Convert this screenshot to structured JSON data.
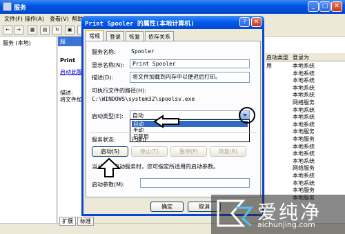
{
  "bg_window": {
    "title": "服务",
    "menu": [
      "文件(F)",
      "操作(A)",
      "查看(V)",
      "帮助(H)"
    ],
    "tree_item": "服务 (本地)",
    "mid_pane_header": "服",
    "mid_texts": [
      "Print",
      "启动此服",
      "描述:",
      "将文件加"
    ],
    "status_tabs": [
      "扩展",
      "标准"
    ],
    "right_pane": {
      "columns": [
        "启动类型",
        "登录为"
      ],
      "rows": [
        [
          "用",
          "本地系统"
        ],
        [
          "",
          "本地系统"
        ],
        [
          "",
          "本地系统"
        ],
        [
          "",
          "本地系统"
        ],
        [
          "",
          "本地系统"
        ],
        [
          "",
          "网络服务"
        ],
        [
          "",
          "本地系统"
        ],
        [
          "",
          "本地系统"
        ],
        [
          "",
          "本地系统"
        ],
        [
          "",
          "本地服务"
        ],
        [
          "",
          "本地服务"
        ],
        [
          "",
          "本地系统"
        ],
        [
          "",
          "本地系统"
        ],
        [
          "",
          "本地系统"
        ],
        [
          "",
          "网络服务"
        ],
        [
          "",
          "本地系统"
        ],
        [
          "",
          "本地系统"
        ],
        [
          "",
          "本地服务"
        ],
        [
          "",
          "本地服务"
        ]
      ]
    }
  },
  "dialog": {
    "title": "Print Spooler 的属性(本地计算机)",
    "tabs": [
      "常规",
      "登录",
      "恢复",
      "依存关系"
    ],
    "service_name_label": "服务名称:",
    "service_name_value": "Spooler",
    "display_name_label": "显示名称(N):",
    "display_name_value": "Print Spooler",
    "description_label": "描述(D):",
    "description_value": "将文件加载到内存中以便迟后打印。",
    "exe_path_label": "可执行文件的路径(H):",
    "exe_path_value": "C:\\WINDOWS\\system32\\spoolsv.exe",
    "startup_type_label": "启动类型(E):",
    "startup_type_value": "自动",
    "startup_options": [
      "自动",
      "手动",
      "已禁用"
    ],
    "status_label": "服务状态:",
    "status_value": "已停止",
    "buttons": {
      "start": "启动(S)",
      "stop": "停止(T)",
      "pause": "暂停(P)",
      "resume": "恢复(R)"
    },
    "hint": "当从此处启动服务时，您可指定所适用的启动参数。",
    "start_params_label": "启动参数(M):",
    "ok": "确定",
    "cancel": "取消"
  },
  "watermark": {
    "brand": "爱纯净",
    "url": "aichunjing.com"
  }
}
